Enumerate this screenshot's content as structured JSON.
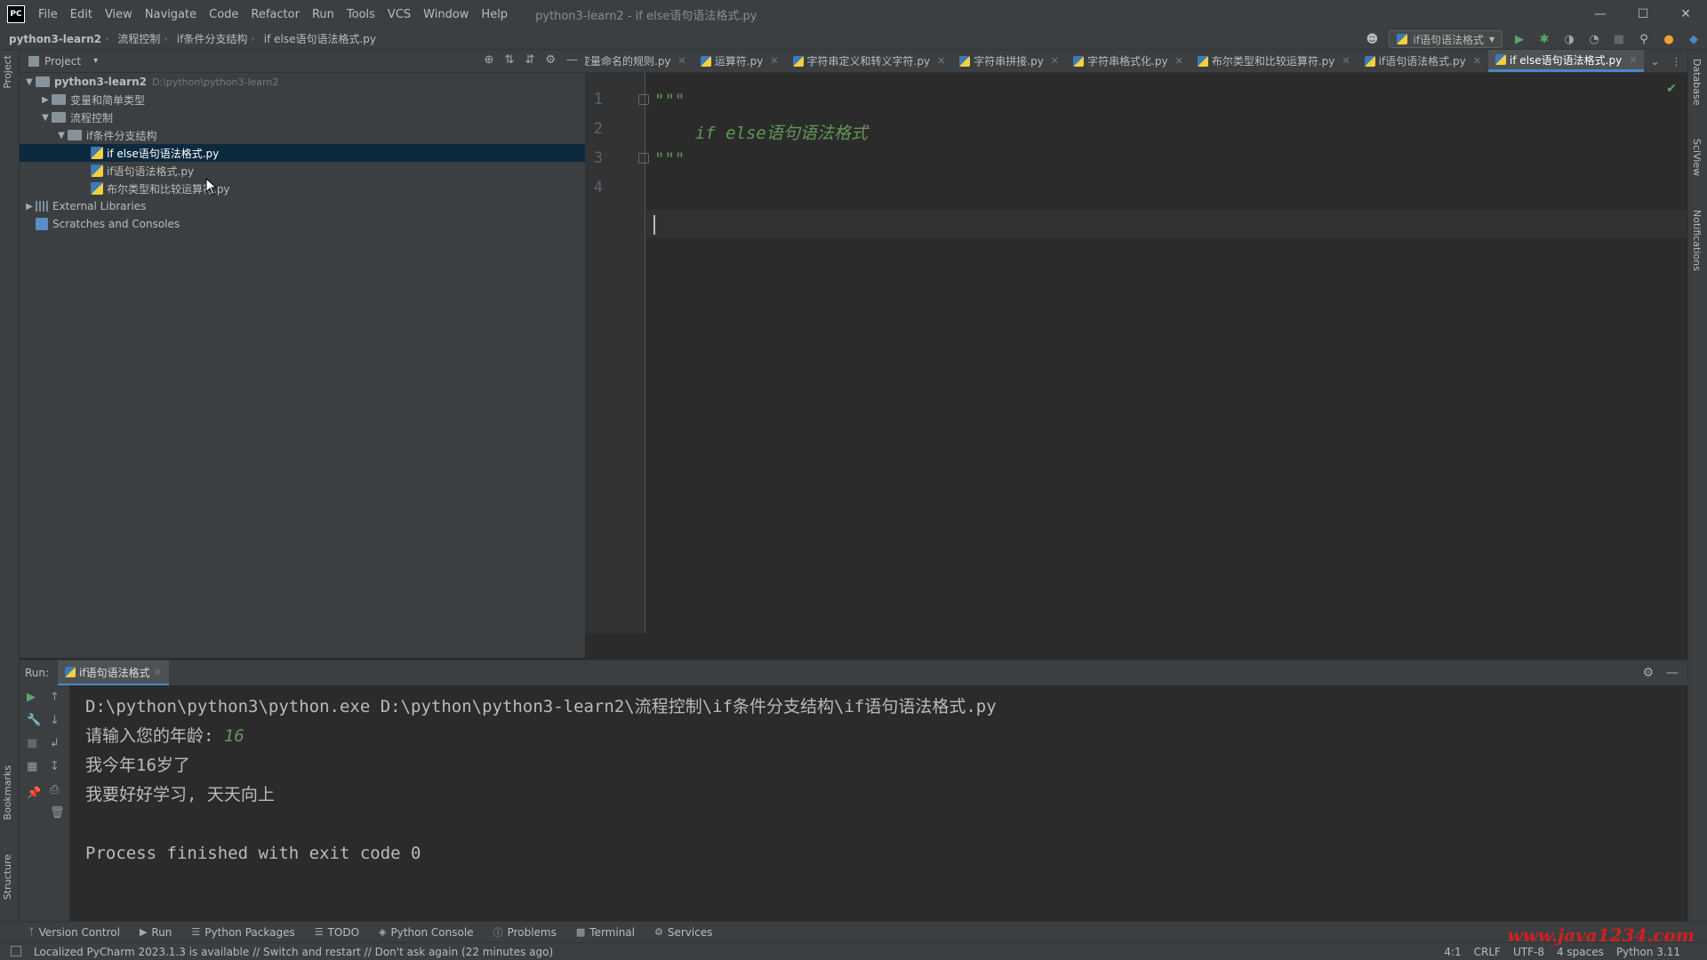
{
  "app": {
    "logo": "PC",
    "menu": [
      "File",
      "Edit",
      "View",
      "Navigate",
      "Code",
      "Refactor",
      "Run",
      "Tools",
      "VCS",
      "Window",
      "Help"
    ],
    "window_title": "python3-learn2 - if else语句语法格式.py"
  },
  "breadcrumb": [
    "python3-learn2",
    "流程控制",
    "if条件分支结构",
    "if else语句语法格式.py"
  ],
  "run_config": {
    "label": "if语句语法格式"
  },
  "project_panel": {
    "title": "Project",
    "tree": [
      {
        "label": "python3-learn2",
        "path": "D:\\python\\python3-learn2"
      },
      {
        "label": "变量和简单类型"
      },
      {
        "label": "流程控制"
      },
      {
        "label": "if条件分支结构"
      },
      {
        "label": "if else语句语法格式.py"
      },
      {
        "label": "if语句语法格式.py"
      },
      {
        "label": "布尔类型和比较运算符.py"
      },
      {
        "label": "External Libraries"
      },
      {
        "label": "Scratches and Consoles"
      }
    ]
  },
  "editor": {
    "tabs": [
      "变量命名的规则.py",
      "运算符.py",
      "字符串定义和转义字符.py",
      "字符串拼接.py",
      "字符串格式化.py",
      "布尔类型和比较运算符.py",
      "if语句语法格式.py",
      "if else语句语法格式.py"
    ],
    "line_numbers": [
      "1",
      "2",
      "3",
      "4"
    ],
    "lines": [
      "\"\"\"",
      "    if else语句语法格式",
      "\"\"\"",
      ""
    ]
  },
  "run_panel": {
    "label": "Run:",
    "tab": "if语句语法格式",
    "console": {
      "cmd": "D:\\python\\python3\\python.exe D:\\python\\python3-learn2\\流程控制\\if条件分支结构\\if语句语法格式.py",
      "prompt": "请输入您的年龄: ",
      "input": "16",
      "out1": "我今年16岁了",
      "out2": "我要好好学习, 天天向上",
      "exit": "Process finished with exit code 0"
    }
  },
  "left_strip": {
    "project": "Project",
    "bookmarks": "Bookmarks",
    "structure": "Structure"
  },
  "right_strip": {
    "database": "Database",
    "sciview": "SciView",
    "notifications": "Notifications"
  },
  "bottom_tabs": [
    "Version Control",
    "Run",
    "Python Packages",
    "TODO",
    "Python Console",
    "Problems",
    "Terminal",
    "Services"
  ],
  "status": {
    "message": "Localized PyCharm 2023.1.3 is available // Switch and restart // Don't ask again (22 minutes ago)",
    "position": "4:1",
    "line_sep": "CRLF",
    "encoding": "UTF-8",
    "indent": "4 spaces",
    "interpreter": "Python 3.11"
  },
  "watermark": "www.java1234.com",
  "colors": {
    "selection": "#0d293e",
    "accent": "#4a88c7",
    "docstring": "#629755"
  }
}
